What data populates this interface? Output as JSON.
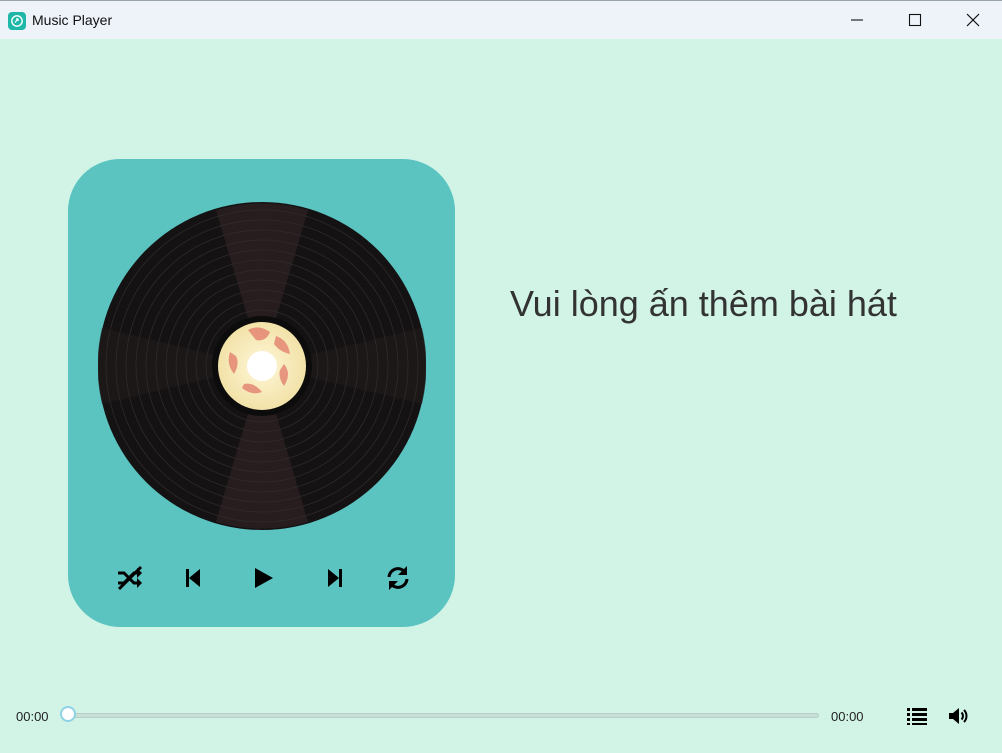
{
  "window": {
    "title": "Music Player",
    "icon": "music-app-icon",
    "controls": [
      "minimize-icon",
      "maximize-icon",
      "close-icon"
    ]
  },
  "player": {
    "disc_icon": "vinyl-record-icon",
    "controls": [
      {
        "name": "shuffle",
        "icon": "shuffle-off-icon"
      },
      {
        "name": "previous",
        "icon": "skip-previous-icon"
      },
      {
        "name": "play",
        "icon": "play-icon"
      },
      {
        "name": "next",
        "icon": "skip-next-icon"
      },
      {
        "name": "repeat",
        "icon": "repeat-icon"
      }
    ]
  },
  "message": "Vui lòng ấn thêm bài hát",
  "playback": {
    "current_time": "00:00",
    "total_time": "00:00",
    "progress": 0
  },
  "bottom_icons": [
    "playlist-icon",
    "volume-icon"
  ],
  "colors": {
    "background": "#d1f4e7",
    "card": "#5bc3c0",
    "title_bar": "#eef3f9",
    "app_icon": "#1fb8a8",
    "disc": "#1c1a1b",
    "disc_label": "#f6e9b8",
    "slider_thumb_border": "#8fd1e6"
  }
}
